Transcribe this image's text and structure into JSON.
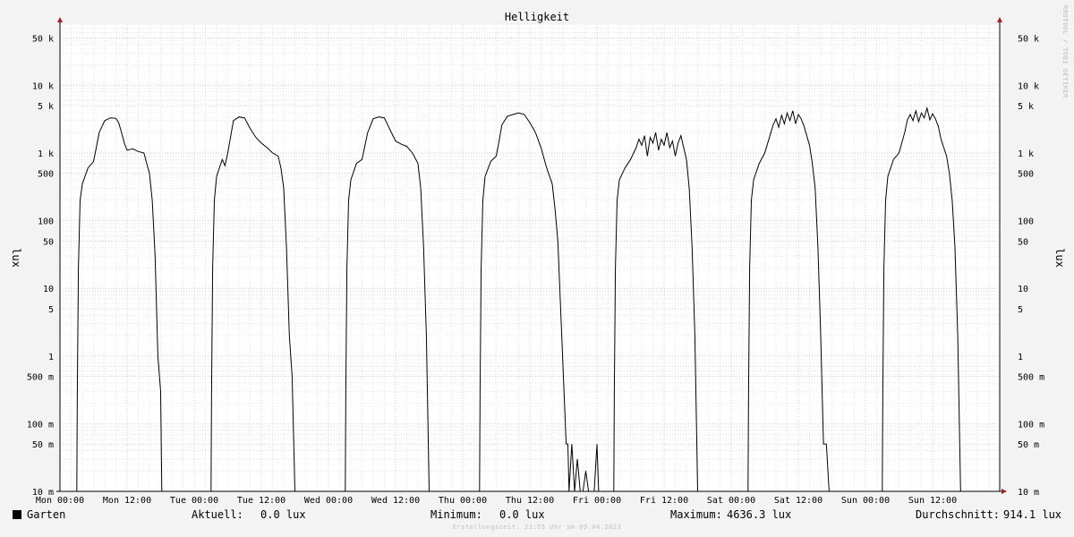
{
  "chart_data": {
    "type": "line",
    "title": "Helligkeit",
    "ylabel": "lux",
    "yscale": "log",
    "ylim": [
      0.01,
      80000
    ],
    "x_tick_labels": [
      "Mon 00:00",
      "Mon 12:00",
      "Tue 00:00",
      "Tue 12:00",
      "Wed 00:00",
      "Wed 12:00",
      "Thu 00:00",
      "Thu 12:00",
      "Fri 00:00",
      "Fri 12:00",
      "Sat 00:00",
      "Sat 12:00",
      "Sun 00:00",
      "Sun 12:00"
    ],
    "x_tick_hours": [
      0,
      12,
      24,
      36,
      48,
      60,
      72,
      84,
      96,
      108,
      120,
      132,
      144,
      156
    ],
    "x_range_hours": [
      0,
      168
    ],
    "y_ticks": [
      {
        "value": 0.01,
        "label": "10 m"
      },
      {
        "value": 0.05,
        "label": "50 m"
      },
      {
        "value": 0.1,
        "label": "100 m"
      },
      {
        "value": 0.5,
        "label": "500 m"
      },
      {
        "value": 1,
        "label": "1"
      },
      {
        "value": 5,
        "label": "5"
      },
      {
        "value": 10,
        "label": "10"
      },
      {
        "value": 50,
        "label": "50"
      },
      {
        "value": 100,
        "label": "100"
      },
      {
        "value": 500,
        "label": "500"
      },
      {
        "value": 1000,
        "label": "1 k"
      },
      {
        "value": 5000,
        "label": "5 k"
      },
      {
        "value": 10000,
        "label": "10 k"
      },
      {
        "value": 50000,
        "label": "50 k"
      }
    ],
    "grid": true,
    "series": [
      {
        "name": "Garten",
        "color": "#000000",
        "points": [
          [
            0,
            0.01
          ],
          [
            3,
            0.01
          ],
          [
            3.1,
            0.3
          ],
          [
            3.3,
            20
          ],
          [
            3.6,
            200
          ],
          [
            4,
            350
          ],
          [
            5,
            600
          ],
          [
            6,
            750
          ],
          [
            6.5,
            1200
          ],
          [
            7,
            2000
          ],
          [
            8,
            3000
          ],
          [
            9,
            3300
          ],
          [
            10,
            3250
          ],
          [
            10.5,
            2800
          ],
          [
            11,
            2000
          ],
          [
            11.5,
            1400
          ],
          [
            12,
            1100
          ],
          [
            13,
            1150
          ],
          [
            14,
            1050
          ],
          [
            15,
            1000
          ],
          [
            15.5,
            700
          ],
          [
            16,
            500
          ],
          [
            16.5,
            200
          ],
          [
            17,
            30
          ],
          [
            17.5,
            1
          ],
          [
            18,
            0.3
          ],
          [
            18.2,
            0.01
          ],
          [
            24,
            0.01
          ],
          [
            27,
            0.01
          ],
          [
            27.1,
            0.3
          ],
          [
            27.3,
            20
          ],
          [
            27.6,
            200
          ],
          [
            28,
            450
          ],
          [
            29,
            800
          ],
          [
            29.5,
            650
          ],
          [
            30,
            1000
          ],
          [
            31,
            3000
          ],
          [
            32,
            3400
          ],
          [
            33,
            3300
          ],
          [
            34,
            2300
          ],
          [
            35,
            1700
          ],
          [
            36,
            1400
          ],
          [
            37,
            1200
          ],
          [
            38,
            1000
          ],
          [
            39,
            900
          ],
          [
            39.5,
            600
          ],
          [
            40,
            300
          ],
          [
            40.5,
            40
          ],
          [
            41,
            2
          ],
          [
            41.5,
            0.5
          ],
          [
            42,
            0.01
          ],
          [
            48,
            0.01
          ],
          [
            51,
            0.01
          ],
          [
            51.1,
            0.3
          ],
          [
            51.3,
            20
          ],
          [
            51.6,
            200
          ],
          [
            52,
            400
          ],
          [
            53,
            700
          ],
          [
            54,
            800
          ],
          [
            55,
            2000
          ],
          [
            56,
            3200
          ],
          [
            57,
            3400
          ],
          [
            58,
            3300
          ],
          [
            59,
            2200
          ],
          [
            60,
            1500
          ],
          [
            61,
            1350
          ],
          [
            62,
            1250
          ],
          [
            63,
            1000
          ],
          [
            64,
            700
          ],
          [
            64.5,
            300
          ],
          [
            65,
            40
          ],
          [
            65.5,
            2
          ],
          [
            66,
            0.01
          ],
          [
            72,
            0.01
          ],
          [
            75,
            0.01
          ],
          [
            75.1,
            0.3
          ],
          [
            75.3,
            20
          ],
          [
            75.6,
            200
          ],
          [
            76,
            450
          ],
          [
            77,
            750
          ],
          [
            78,
            900
          ],
          [
            78.5,
            1500
          ],
          [
            79,
            2600
          ],
          [
            80,
            3500
          ],
          [
            81,
            3700
          ],
          [
            82,
            3900
          ],
          [
            83,
            3700
          ],
          [
            84,
            2800
          ],
          [
            85,
            2000
          ],
          [
            86,
            1200
          ],
          [
            87,
            600
          ],
          [
            88,
            350
          ],
          [
            88.5,
            150
          ],
          [
            89,
            50
          ],
          [
            89.5,
            5
          ],
          [
            90,
            0.5
          ],
          [
            90.5,
            0.05
          ],
          [
            90.8,
            0.05
          ],
          [
            91,
            0.01
          ],
          [
            91.5,
            0.05
          ],
          [
            92,
            0.01
          ],
          [
            92.5,
            0.03
          ],
          [
            93,
            0.01
          ],
          [
            93.5,
            0.01
          ],
          [
            94,
            0.02
          ],
          [
            94.5,
            0.01
          ],
          [
            95.5,
            0.01
          ],
          [
            96,
            0.05
          ],
          [
            96.3,
            0.01
          ],
          [
            99,
            0.01
          ],
          [
            99.1,
            0.3
          ],
          [
            99.3,
            20
          ],
          [
            99.6,
            200
          ],
          [
            100,
            400
          ],
          [
            101,
            600
          ],
          [
            102,
            800
          ],
          [
            103,
            1200
          ],
          [
            103.5,
            1600
          ],
          [
            104,
            1300
          ],
          [
            104.5,
            1800
          ],
          [
            105,
            900
          ],
          [
            105.5,
            1700
          ],
          [
            106,
            1400
          ],
          [
            106.5,
            2000
          ],
          [
            107,
            1100
          ],
          [
            107.5,
            1600
          ],
          [
            108,
            1300
          ],
          [
            108.5,
            2000
          ],
          [
            109,
            1200
          ],
          [
            109.5,
            1500
          ],
          [
            110,
            900
          ],
          [
            110.5,
            1400
          ],
          [
            111,
            1800
          ],
          [
            112,
            800
          ],
          [
            112.5,
            300
          ],
          [
            113,
            40
          ],
          [
            113.5,
            2
          ],
          [
            114,
            0.01
          ],
          [
            120,
            0.01
          ],
          [
            123,
            0.01
          ],
          [
            123.1,
            0.3
          ],
          [
            123.3,
            20
          ],
          [
            123.6,
            200
          ],
          [
            124,
            400
          ],
          [
            125,
            700
          ],
          [
            126,
            1000
          ],
          [
            127,
            1900
          ],
          [
            127.5,
            2600
          ],
          [
            128,
            3200
          ],
          [
            128.5,
            2400
          ],
          [
            129,
            3600
          ],
          [
            129.5,
            2700
          ],
          [
            130,
            3900
          ],
          [
            130.5,
            3000
          ],
          [
            131,
            4200
          ],
          [
            131.5,
            2700
          ],
          [
            132,
            3700
          ],
          [
            132.5,
            3200
          ],
          [
            133,
            2500
          ],
          [
            134,
            1300
          ],
          [
            134.5,
            700
          ],
          [
            135,
            300
          ],
          [
            135.5,
            40
          ],
          [
            136,
            2
          ],
          [
            136.5,
            0.05
          ],
          [
            137,
            0.05
          ],
          [
            137.5,
            0.01
          ],
          [
            144,
            0.01
          ],
          [
            147,
            0.01
          ],
          [
            147.1,
            0.3
          ],
          [
            147.3,
            20
          ],
          [
            147.6,
            200
          ],
          [
            148,
            450
          ],
          [
            149,
            800
          ],
          [
            150,
            1000
          ],
          [
            151,
            2000
          ],
          [
            151.5,
            3100
          ],
          [
            152,
            3700
          ],
          [
            152.5,
            3000
          ],
          [
            153,
            4200
          ],
          [
            153.5,
            2900
          ],
          [
            154,
            3900
          ],
          [
            154.5,
            3300
          ],
          [
            155,
            4600
          ],
          [
            155.5,
            3100
          ],
          [
            156,
            3800
          ],
          [
            156.5,
            3200
          ],
          [
            157,
            2500
          ],
          [
            157.5,
            1600
          ],
          [
            158,
            1200
          ],
          [
            158.5,
            900
          ],
          [
            159,
            500
          ],
          [
            159.5,
            200
          ],
          [
            160,
            40
          ],
          [
            160.5,
            2
          ],
          [
            161,
            0.01
          ],
          [
            162,
            0.01
          ]
        ]
      }
    ],
    "legend": {
      "series_name": "Garten",
      "aktuell_label": "Aktuell:",
      "aktuell_value": "0.0 lux",
      "minimum_label": "Minimum:",
      "minimum_value": "0.0 lux",
      "maximum_label": "Maximum:",
      "maximum_value": "4636.3 lux",
      "avg_label": "Durchschnitt:",
      "avg_value": "914.1 lux"
    },
    "footer": "Erstellungszeit: 23:55 Uhr am 09.04.2023",
    "watermark": "RRDTOOL / TOBI OETIKER"
  },
  "colors": {
    "background": "#f3f3f3",
    "plot_background": "#ffffff",
    "grid_major": "#e8a0a0",
    "grid_minor": "#d0d0d0",
    "axis": "#000000",
    "arrow": "#a02020",
    "line": "#000000"
  }
}
